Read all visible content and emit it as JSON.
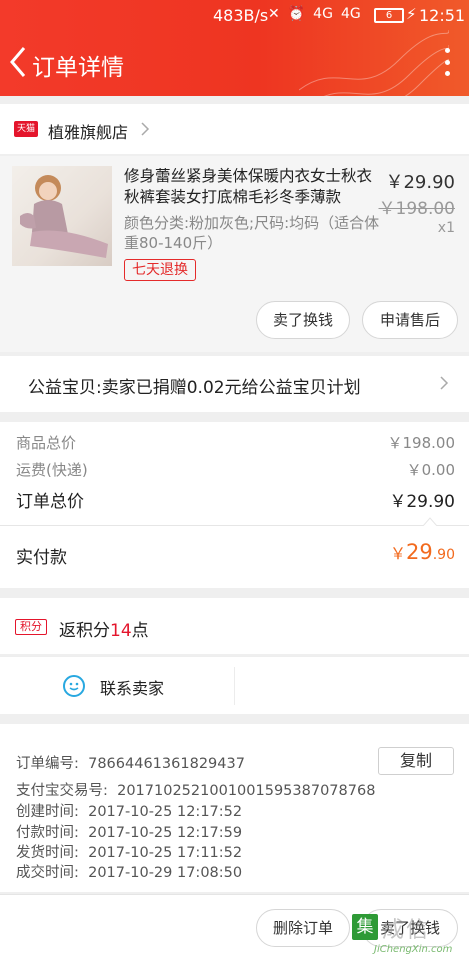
{
  "status_bar": {
    "speed": "483B/s",
    "signal_left": "4G",
    "signal_right": "4G",
    "battery": "6",
    "time": "12:51"
  },
  "nav": {
    "title": "订单详情"
  },
  "shop": {
    "badge": "天猫",
    "name": "植雅旗舰店"
  },
  "product": {
    "title": "修身蕾丝紧身美体保暖内衣女士秋衣秋裤套装女打底棉毛衫冬季薄款",
    "spec": "颜色分类:粉加灰色;尺码:均码（适合体重80-140斤）",
    "price": "￥29.90",
    "original_price": "￥198.00",
    "quantity": "x1",
    "return_tag": "七天退换",
    "sell_label": "卖了换钱",
    "after_sale_label": "申请售后"
  },
  "charity": {
    "text": "公益宝贝:卖家已捐赠0.02元给公益宝贝计划"
  },
  "totals": {
    "goods_label": "商品总价",
    "goods_value": "￥198.00",
    "shipping_label": "运费(快递)",
    "shipping_value": "￥0.00",
    "order_label": "订单总价",
    "order_value": "￥29.90",
    "paid_label": "实付款",
    "paid_symbol": "￥",
    "paid_int": "29",
    "paid_dec": ".90"
  },
  "points": {
    "badge": "积分",
    "prefix": "返积分",
    "number": "14",
    "suffix": "点"
  },
  "contact": {
    "label": "联系卖家"
  },
  "order_info": {
    "order_no_label": "订单编号:",
    "order_no": "78664461361829437",
    "alipay_label": "支付宝交易号:",
    "alipay_no": "2017102521001001595387078768",
    "created_label": "创建时间:",
    "created": "2017-10-25 12:17:52",
    "paid_label": "付款时间:",
    "paid": "2017-10-25 12:17:59",
    "shipped_label": "发货时间:",
    "shipped": "2017-10-25 17:11:52",
    "done_label": "成交时间:",
    "done": "2017-10-29 17:08:50",
    "copy_label": "复制"
  },
  "bottom": {
    "delete_label": "删除订单",
    "sell_label": "卖了换钱"
  },
  "watermark": {
    "box": "集",
    "word": "成信",
    "url": "JiChengXin.com"
  },
  "colors": {
    "header": "#ee3521",
    "accent_red": "#e4152c",
    "paid_orange": "#f26a1e"
  }
}
